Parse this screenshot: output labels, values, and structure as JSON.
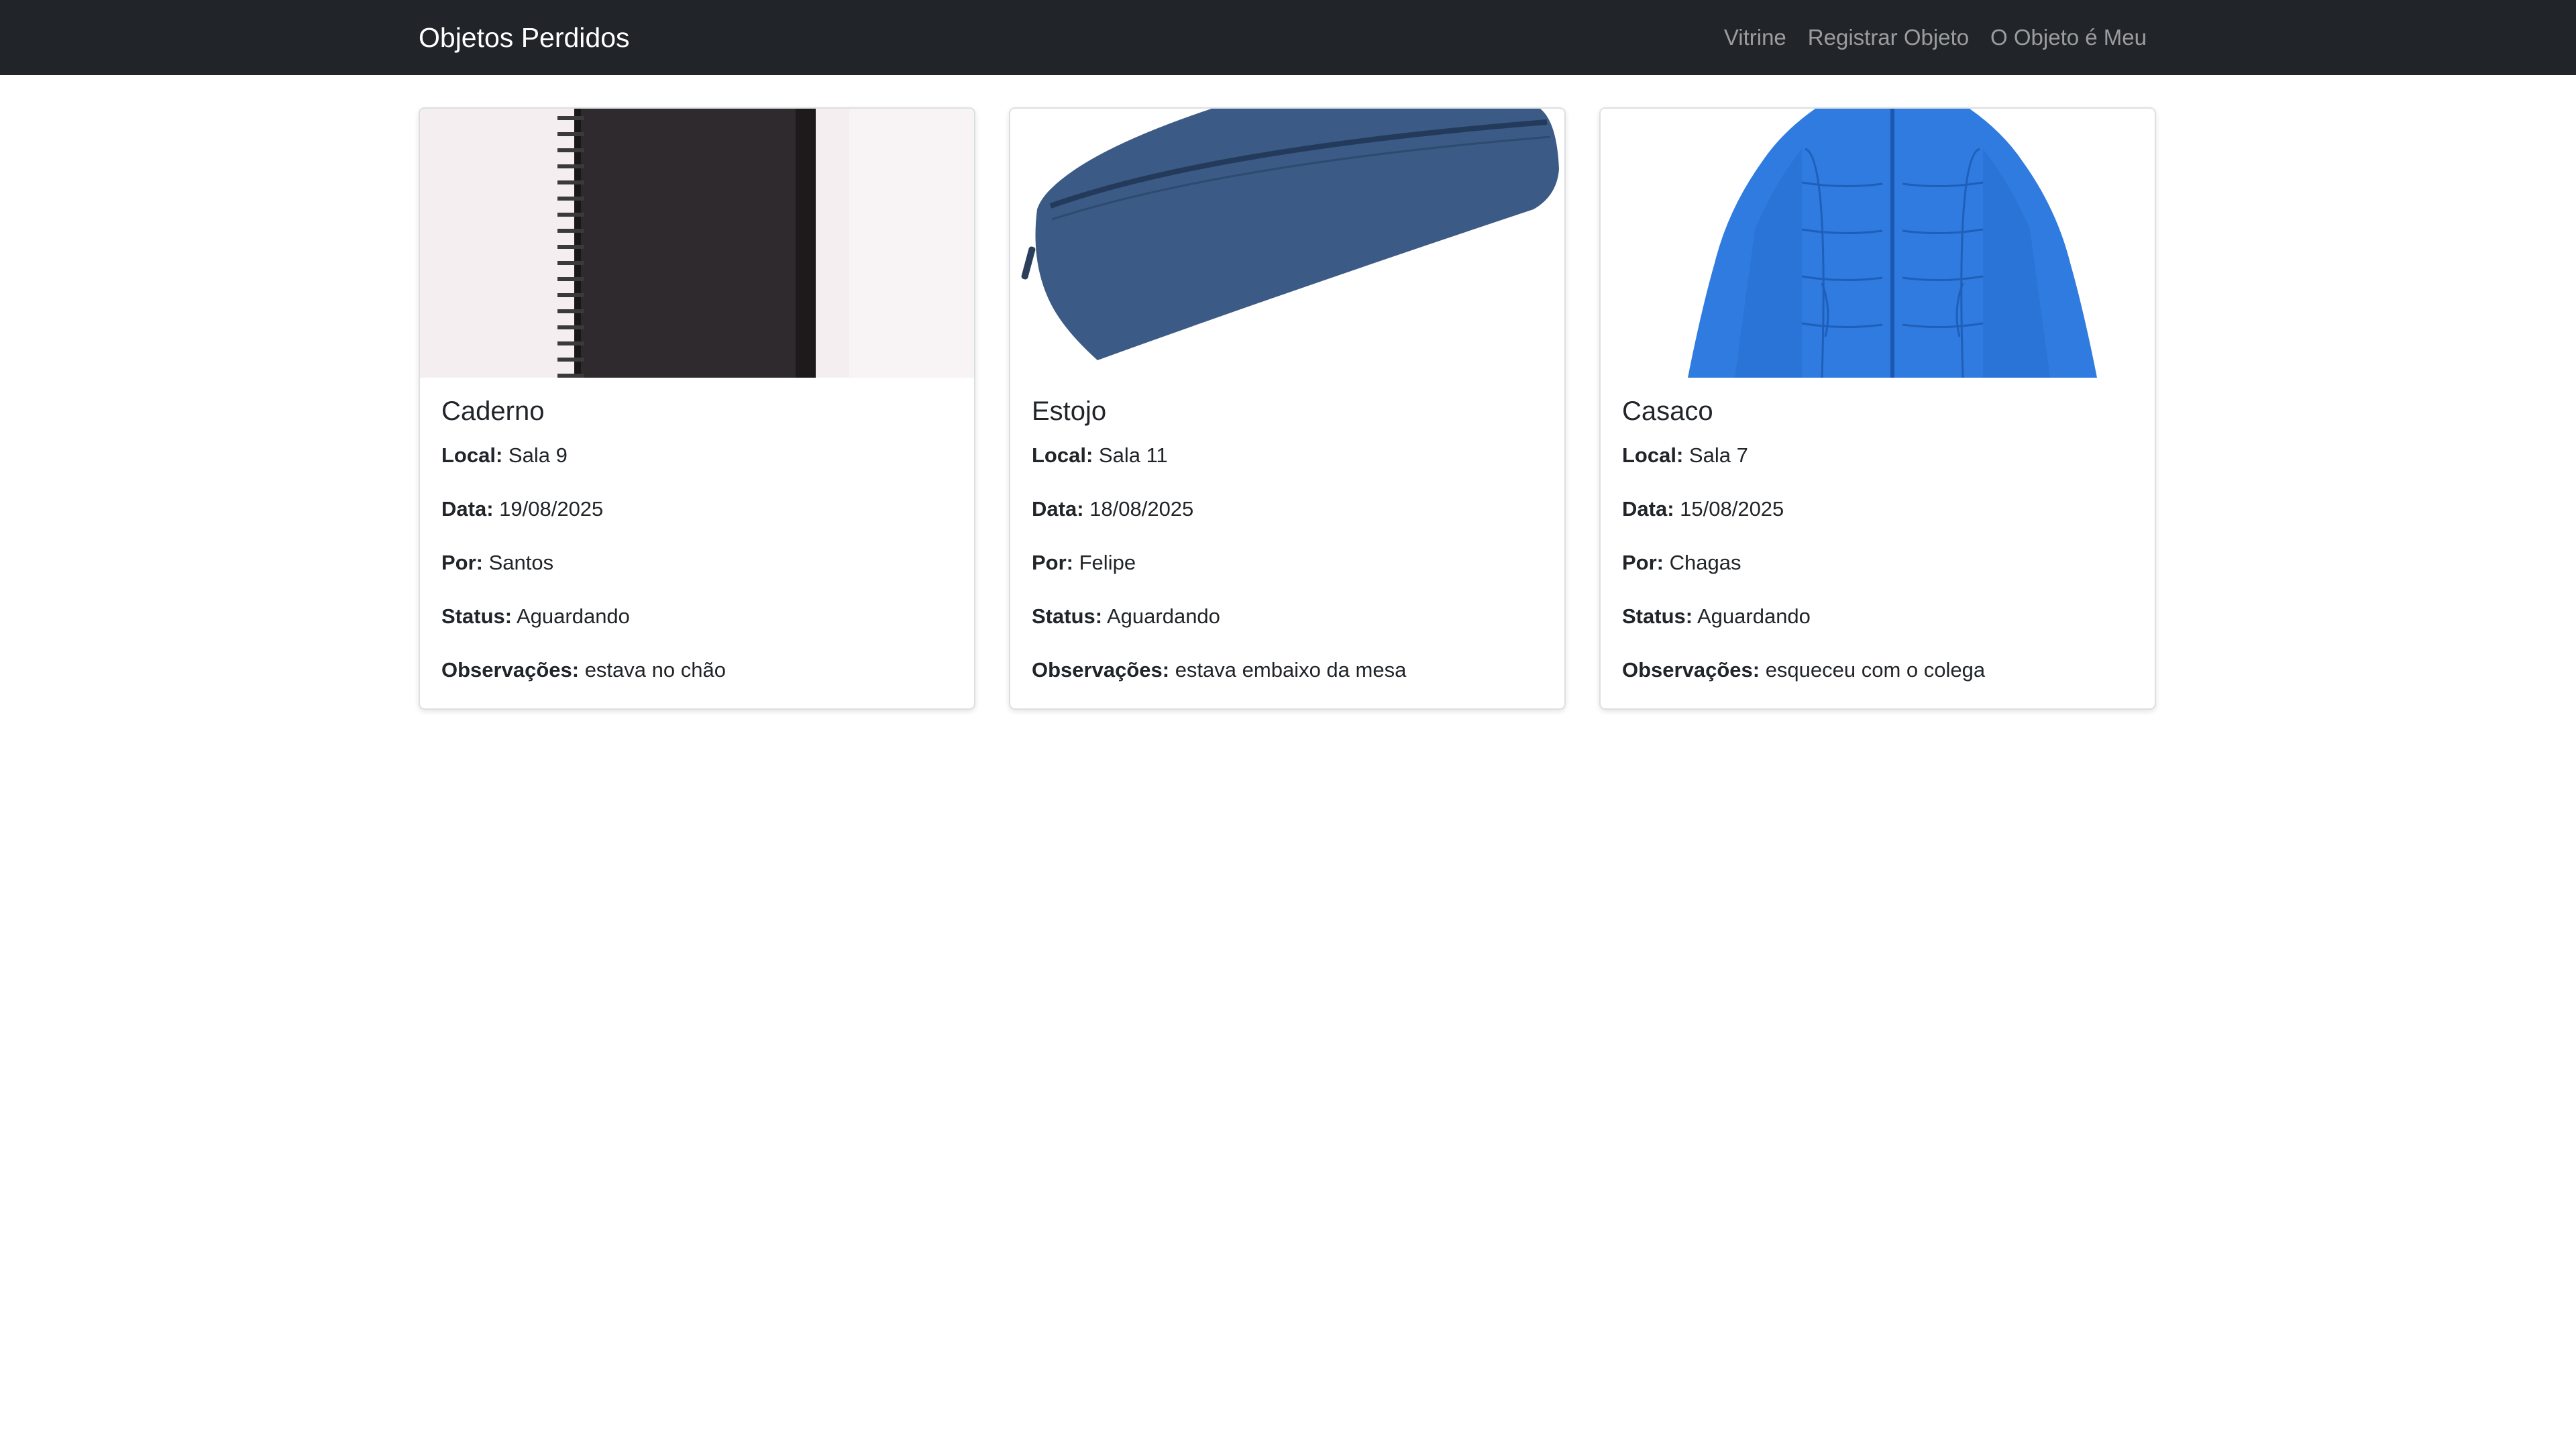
{
  "navbar": {
    "brand": "Objetos Perdidos",
    "links": [
      "Vitrine",
      "Registrar Objeto",
      "O Objeto é Meu"
    ]
  },
  "labels": {
    "local": "Local:",
    "data": "Data:",
    "por": "Por:",
    "status": "Status:",
    "obs": "Observações:"
  },
  "cards": [
    {
      "title": "Caderno",
      "local": "Sala 9",
      "data": "19/08/2025",
      "por": "Santos",
      "status": "Aguardando",
      "obs": "estava no chão"
    },
    {
      "title": "Estojo",
      "local": "Sala 11",
      "data": "18/08/2025",
      "por": "Felipe",
      "status": "Aguardando",
      "obs": "estava embaixo da mesa"
    },
    {
      "title": "Casaco",
      "local": "Sala 7",
      "data": "15/08/2025",
      "por": "Chagas",
      "status": "Aguardando",
      "obs": "esqueceu com o colega"
    }
  ],
  "colors": {
    "navbar_bg": "#212529",
    "notebook": "#2e2a2d",
    "pencil_case": "#3b5a85",
    "jacket": "#2f7be0"
  }
}
